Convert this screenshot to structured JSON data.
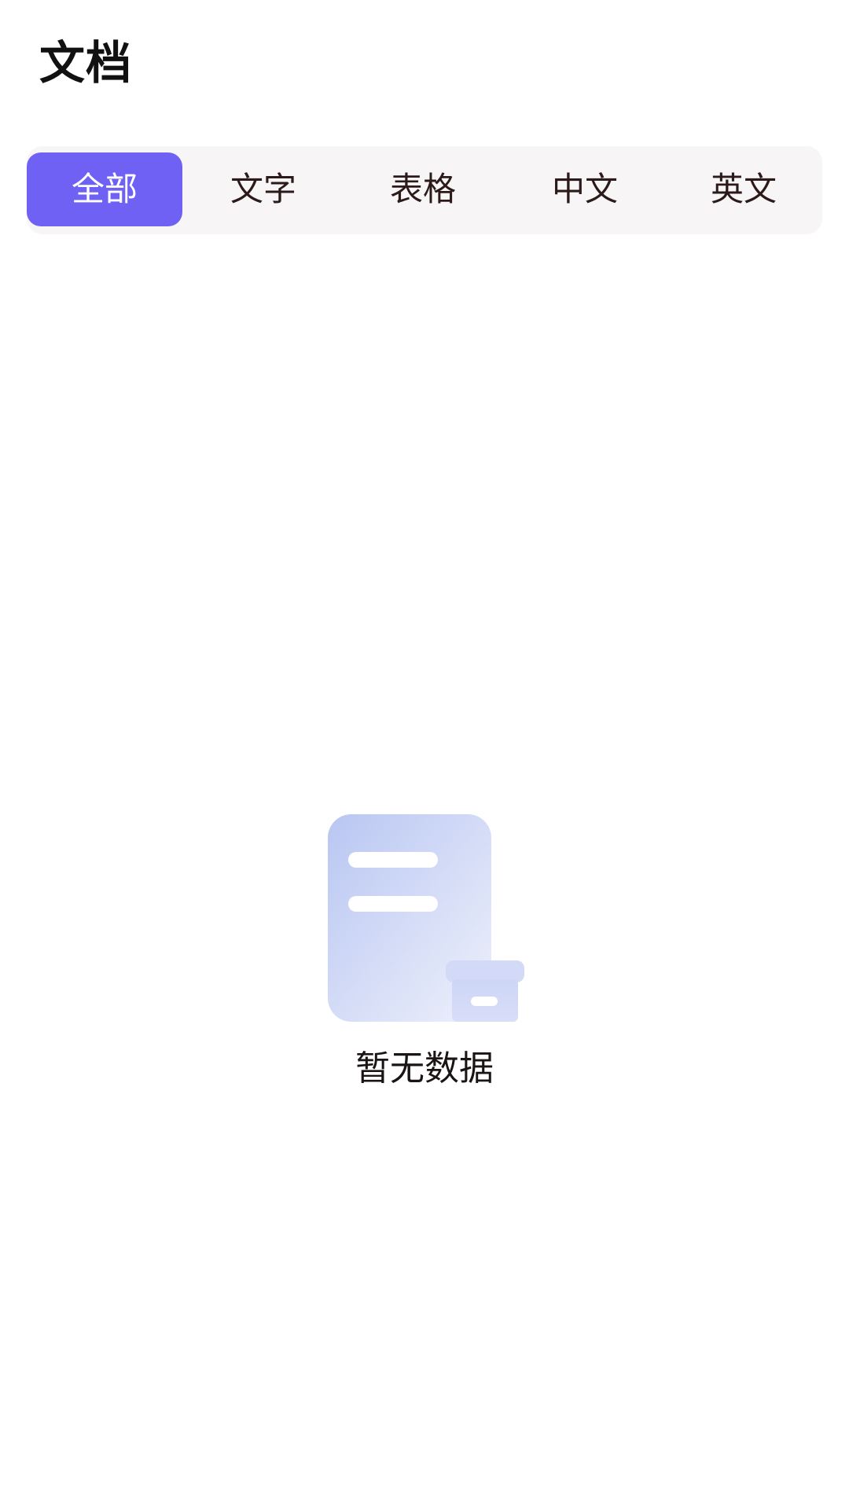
{
  "header": {
    "title": "文档"
  },
  "tabs": [
    {
      "label": "全部",
      "active": true
    },
    {
      "label": "文字",
      "active": false
    },
    {
      "label": "表格",
      "active": false
    },
    {
      "label": "中文",
      "active": false
    },
    {
      "label": "英文",
      "active": false
    }
  ],
  "empty_state": {
    "icon": "empty-document-box-icon",
    "message": "暂无数据"
  },
  "colors": {
    "accent": "#7061f5",
    "tab_bar_bg": "#f7f5f5",
    "icon_gradient_start": "#b9c6f2",
    "icon_gradient_end": "#eef1fb"
  }
}
